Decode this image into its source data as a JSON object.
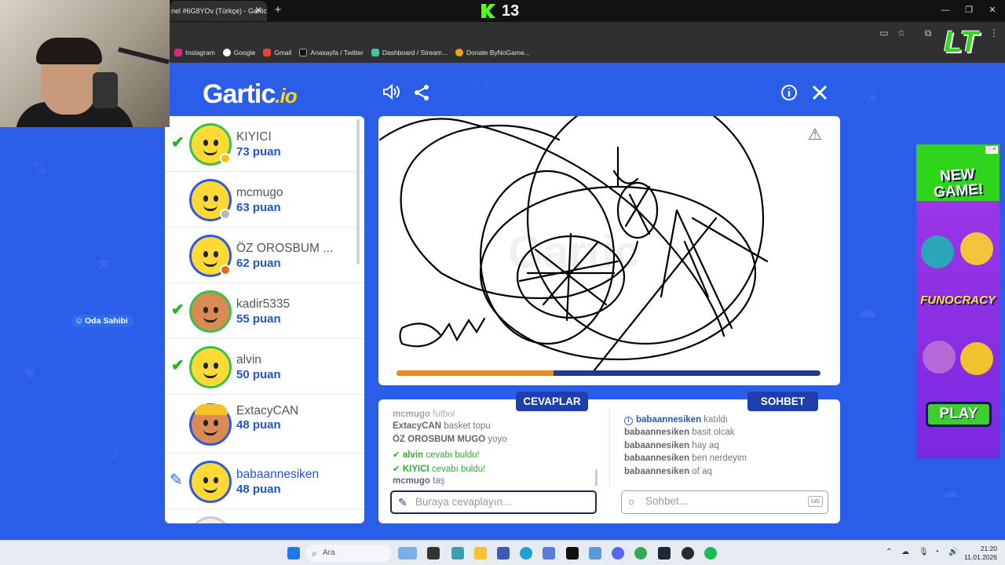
{
  "browser": {
    "tab_title": "nel #6G8YOv (Türkçe) - Gartic",
    "tab_close": "✕",
    "new_tab": "+",
    "kick_count": "13",
    "bookmarks": [
      "Instagram",
      "Google",
      "Gmail",
      "Anasayfa / Twitter",
      "Dashboard / Stream...",
      "Donate ByNoGame..."
    ],
    "streamer_logo": "LT"
  },
  "header": {
    "logo_main": "Gartic",
    "logo_suffix": ".io",
    "icons": [
      "speaker-icon",
      "share-icon",
      "info-icon",
      "close-icon"
    ]
  },
  "players": [
    {
      "name": "KIYICI",
      "score": "73 puan",
      "status": "guessed",
      "badge_color": "#f5c21b"
    },
    {
      "name": "mcmugo",
      "score": "63 puan",
      "status": "none",
      "badge_color": "#b8b8b8"
    },
    {
      "name": "ÖZ OROSBUM ...",
      "score": "62 puan",
      "status": "none",
      "badge_color": "#e06b1b"
    },
    {
      "name": "kadir5335",
      "score": "55 puan",
      "status": "guessed"
    },
    {
      "name": "alvin",
      "score": "50 puan",
      "status": "guessed"
    },
    {
      "name": "ExtacyCAN",
      "score": "48 puan",
      "status": "none",
      "host_label": "Oda Sahibi"
    },
    {
      "name": "babaannesiken",
      "score": "48 puan",
      "status": "drawing"
    }
  ],
  "canvas": {
    "watermark": "Gartic",
    "timer_progress": 0.37
  },
  "answers": {
    "tab_label": "CEVAPLAR",
    "messages": [
      {
        "user": "mcmugo",
        "text": "futbol"
      },
      {
        "user": "ExtacyCAN",
        "text": "basket topu"
      },
      {
        "user": "ÖZ OROSBUM MUGO",
        "text": "yoyo"
      },
      {
        "user": "alvin",
        "text": "cevabı buldu!",
        "correct": true
      },
      {
        "user": "KIYICI",
        "text": "cevabı buldu!",
        "correct": true
      },
      {
        "user": "mcmugo",
        "text": "taş"
      }
    ],
    "placeholder": "Buraya cevaplayın..."
  },
  "chat": {
    "tab_label": "SOHBET",
    "messages": [
      {
        "user": "babaannesiken",
        "text": "katıldı",
        "system": true
      },
      {
        "user": "babaannesiken",
        "text": "basit olcak"
      },
      {
        "user": "babaannesiken",
        "text": "hay aq"
      },
      {
        "user": "babaannesiken",
        "text": "ben nerdeyim"
      },
      {
        "user": "babaannesiken",
        "text": "of aq"
      }
    ],
    "placeholder": "Sohbet...",
    "tab_key": "tab"
  },
  "ad": {
    "headline": "NEW GAME!",
    "brand": "FUNOCRACY",
    "cta": "PLAY"
  },
  "taskbar": {
    "search_label": "Ara",
    "time": "21:20",
    "date": "11.01.2026"
  },
  "colors": {
    "page_bg": "#2b5ee8",
    "score_blue": "#2255c8",
    "correct_green": "#2fae2f",
    "timer_orange": "#f08a1f"
  }
}
